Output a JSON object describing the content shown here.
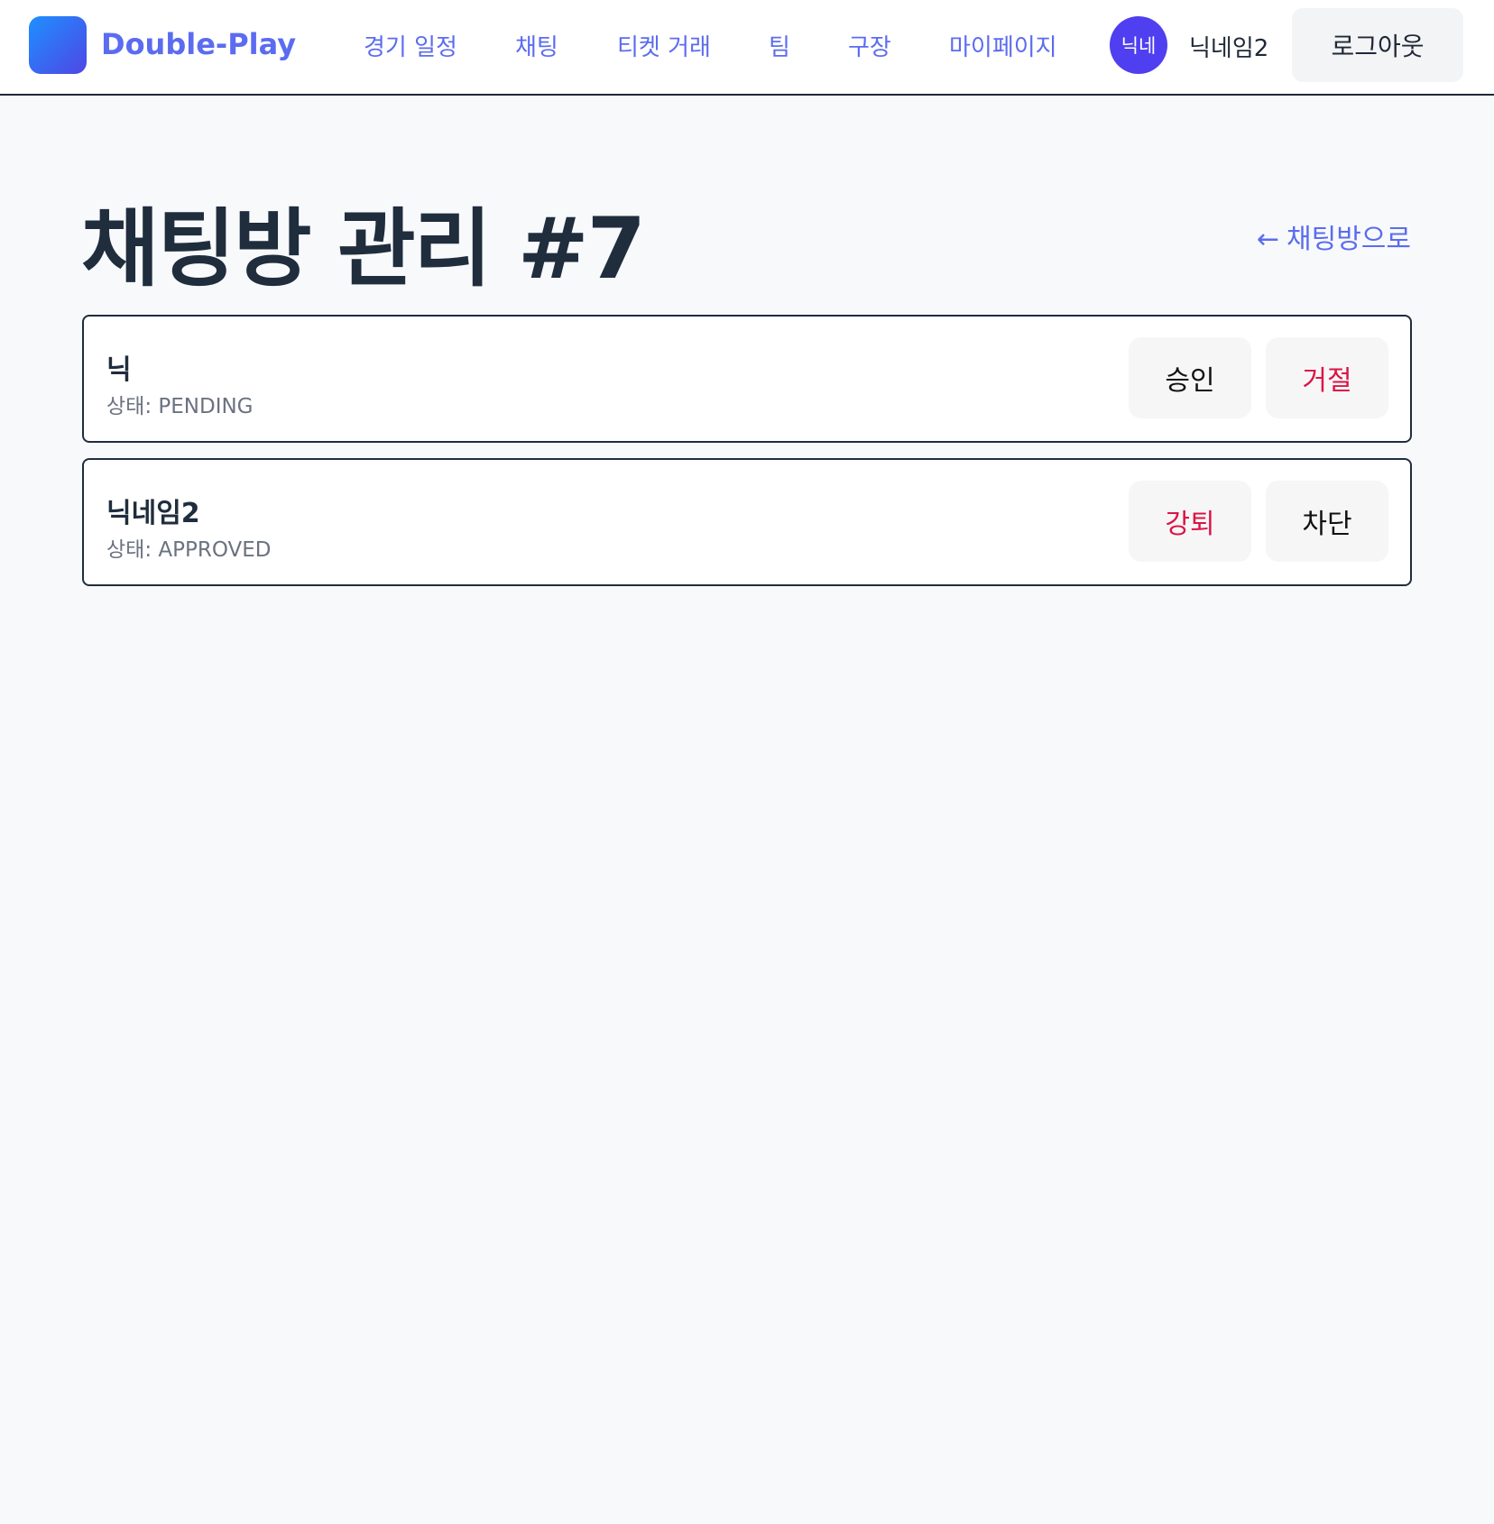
{
  "header": {
    "brand": "Double-Play",
    "nav": [
      "경기 일정",
      "채팅",
      "티켓 거래",
      "팀",
      "구장",
      "마이페이지"
    ],
    "avatar_text": "닉네",
    "username": "닉네임2",
    "logout_label": "로그아웃"
  },
  "page": {
    "title": "채팅방 관리 #7",
    "back_arrow": "←",
    "back_label": "채팅방으로"
  },
  "members": [
    {
      "name": "닉",
      "status": "상태: PENDING",
      "actions": [
        "승인",
        "거절"
      ]
    },
    {
      "name": "닉네임2",
      "status": "상태: APPROVED",
      "actions": [
        "강퇴",
        "차단"
      ]
    }
  ],
  "colors": {
    "accent": "#5b6cf0",
    "avatar_bg": "#4f3ff0",
    "danger": "#dc1445",
    "page_bg": "#f8f9fb"
  }
}
